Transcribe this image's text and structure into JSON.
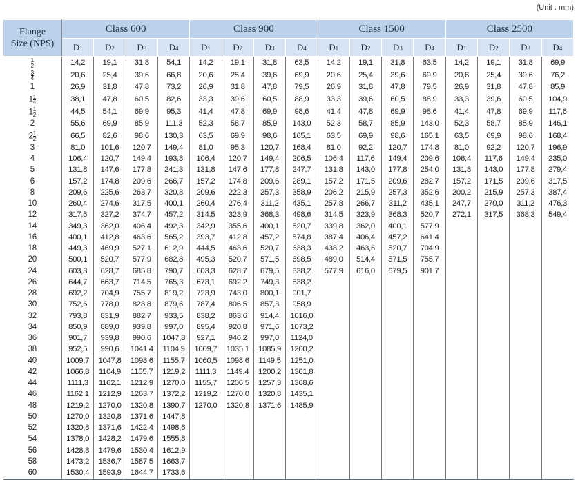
{
  "unit_note": "(Unit : mm)",
  "header": {
    "flange_size": [
      "Flange",
      "Size (NPS)"
    ],
    "classes": [
      "Class 600",
      "Class 900",
      "Class 1500",
      "Class 2500"
    ],
    "dims": [
      "D",
      "D",
      "D",
      "D"
    ],
    "dim_subs": [
      "1",
      "2",
      "3",
      "4"
    ]
  },
  "rows": [
    {
      "size": {
        "whole": "",
        "num": "1",
        "den": "2"
      },
      "vals": [
        "14,2",
        "19,1",
        "31,8",
        "54,1",
        "14,2",
        "19,1",
        "31,8",
        "63,5",
        "14,2",
        "19,1",
        "31,8",
        "63,5",
        "14,2",
        "19,1",
        "31,8",
        "69,9"
      ]
    },
    {
      "size": {
        "whole": "",
        "num": "3",
        "den": "4"
      },
      "vals": [
        "20,6",
        "25,4",
        "39,6",
        "66,8",
        "20,6",
        "25,4",
        "39,6",
        "69,9",
        "20,6",
        "25,4",
        "39,6",
        "69,9",
        "20,6",
        "25,4",
        "39,6",
        "76,2"
      ]
    },
    {
      "size": {
        "whole": "1"
      },
      "vals": [
        "26,9",
        "31,8",
        "47,8",
        "73,2",
        "26,9",
        "31,8",
        "47,8",
        "79,5",
        "26,9",
        "31,8",
        "47,8",
        "79,5",
        "26,9",
        "31,8",
        "47,8",
        "85,9"
      ]
    },
    {
      "size": {
        "whole": "1",
        "num": "1",
        "den": "4"
      },
      "vals": [
        "38,1",
        "47,8",
        "60,5",
        "82,6",
        "33,3",
        "39,6",
        "60,5",
        "88,9",
        "33,3",
        "39,6",
        "60,5",
        "88,9",
        "33,3",
        "39,6",
        "60,5",
        "104,9"
      ]
    },
    {
      "size": {
        "whole": "1",
        "num": "1",
        "den": "2"
      },
      "vals": [
        "44,5",
        "54,1",
        "69,9",
        "95,3",
        "41,4",
        "47,8",
        "69,9",
        "98,6",
        "41,4",
        "47,8",
        "69,9",
        "98,6",
        "41,4",
        "47,8",
        "69,9",
        "117,6"
      ]
    },
    {
      "size": {
        "whole": "2"
      },
      "vals": [
        "55,6",
        "69,9",
        "85,9",
        "111,3",
        "52,3",
        "58,7",
        "85,9",
        "143,0",
        "52,3",
        "58,7",
        "85,9",
        "143,0",
        "52,3",
        "58,7",
        "85,9",
        "146,1"
      ]
    },
    {
      "size": {
        "whole": "2",
        "num": "1",
        "den": "2"
      },
      "vals": [
        "66,5",
        "82,6",
        "98,6",
        "130,3",
        "63,5",
        "69,9",
        "98,6",
        "165,1",
        "63,5",
        "69,9",
        "98,6",
        "165,1",
        "63,5",
        "69,9",
        "98,6",
        "168,4"
      ]
    },
    {
      "size": {
        "whole": "3"
      },
      "vals": [
        "81,0",
        "101,6",
        "120,7",
        "149,4",
        "81,0",
        "95,3",
        "120,7",
        "168,4",
        "81,0",
        "92,2",
        "120,7",
        "174,8",
        "81,0",
        "92,2",
        "120,7",
        "196,9"
      ]
    },
    {
      "size": {
        "whole": "4"
      },
      "vals": [
        "106,4",
        "120,7",
        "149,4",
        "193,8",
        "106,4",
        "120,7",
        "149,4",
        "206,5",
        "106,4",
        "117,6",
        "149,4",
        "209,6",
        "106,4",
        "117,6",
        "149,4",
        "235,0"
      ]
    },
    {
      "size": {
        "whole": "5"
      },
      "vals": [
        "131,8",
        "147,6",
        "177,8",
        "241,3",
        "131,8",
        "147,6",
        "177,8",
        "247,7",
        "131,8",
        "143,0",
        "177,8",
        "254,0",
        "131,8",
        "143,0",
        "177,8",
        "279,4"
      ]
    },
    {
      "size": {
        "whole": "6"
      },
      "vals": [
        "157,2",
        "174,8",
        "209,6",
        "266,7",
        "157,2",
        "174,8",
        "209,6",
        "289,1",
        "157,2",
        "171,5",
        "209,6",
        "282,7",
        "157,2",
        "171,5",
        "209,6",
        "317,5"
      ]
    },
    {
      "size": {
        "whole": "8"
      },
      "vals": [
        "209,6",
        "225,6",
        "263,7",
        "320,8",
        "209,6",
        "222,3",
        "257,3",
        "358,9",
        "206,2",
        "215,9",
        "257,3",
        "352,6",
        "200,2",
        "215,9",
        "257,3",
        "387,4"
      ]
    },
    {
      "size": {
        "whole": "10"
      },
      "vals": [
        "260,4",
        "274,6",
        "317,5",
        "400,1",
        "260,4",
        "276,4",
        "311,2",
        "435,1",
        "257,8",
        "266,7",
        "311,2",
        "435,1",
        "247,7",
        "270,0",
        "311,2",
        "476,3"
      ]
    },
    {
      "size": {
        "whole": "12"
      },
      "vals": [
        "317,5",
        "327,2",
        "374,7",
        "457,2",
        "314,5",
        "323,9",
        "368,3",
        "498,6",
        "314,5",
        "323,9",
        "368,3",
        "520,7",
        "272,1",
        "317,5",
        "368,3",
        "549,4"
      ]
    },
    {
      "size": {
        "whole": "14"
      },
      "vals": [
        "349,3",
        "362,0",
        "406,4",
        "492,3",
        "342,9",
        "355,6",
        "400,1",
        "520,7",
        "339,8",
        "362,0",
        "400,1",
        "577,9",
        "",
        "",
        "",
        ""
      ]
    },
    {
      "size": {
        "whole": "16"
      },
      "vals": [
        "400,1",
        "412,8",
        "463,6",
        "565,2",
        "393,7",
        "412,8",
        "457,2",
        "574,8",
        "387,4",
        "406,4",
        "457,2",
        "641,4",
        "",
        "",
        "",
        ""
      ]
    },
    {
      "size": {
        "whole": "18"
      },
      "vals": [
        "449,3",
        "469,9",
        "527,1",
        "612,9",
        "444,5",
        "463,6",
        "520,7",
        "638,3",
        "438,2",
        "463,6",
        "520,7",
        "704,9",
        "",
        "",
        "",
        ""
      ]
    },
    {
      "size": {
        "whole": "20"
      },
      "vals": [
        "500,1",
        "520,7",
        "577,9",
        "682,8",
        "495,3",
        "520,7",
        "571,5",
        "698,5",
        "489,0",
        "514,4",
        "571,5",
        "755,7",
        "",
        "",
        "",
        ""
      ]
    },
    {
      "size": {
        "whole": "24"
      },
      "vals": [
        "603,3",
        "628,7",
        "685,8",
        "790,7",
        "603,3",
        "628,7",
        "679,5",
        "838,2",
        "577,9",
        "616,0",
        "679,5",
        "901,7",
        "",
        "",
        "",
        ""
      ]
    },
    {
      "size": {
        "whole": "26"
      },
      "vals": [
        "644,7",
        "663,7",
        "714,5",
        "765,3",
        "673,1",
        "692,2",
        "749,3",
        "838,2",
        "",
        "",
        "",
        "",
        "",
        "",
        "",
        ""
      ]
    },
    {
      "size": {
        "whole": "28"
      },
      "vals": [
        "692,2",
        "704,9",
        "755,7",
        "819,2",
        "723,9",
        "743,0",
        "800,1",
        "901,7",
        "",
        "",
        "",
        "",
        "",
        "",
        "",
        ""
      ]
    },
    {
      "size": {
        "whole": "30"
      },
      "vals": [
        "752,6",
        "778,0",
        "828,8",
        "879,6",
        "787,4",
        "806,5",
        "857,3",
        "958,9",
        "",
        "",
        "",
        "",
        "",
        "",
        "",
        ""
      ]
    },
    {
      "size": {
        "whole": "32"
      },
      "vals": [
        "793,8",
        "831,9",
        "882,7",
        "933,5",
        "838,2",
        "863,6",
        "914,4",
        "1016,0",
        "",
        "",
        "",
        "",
        "",
        "",
        "",
        ""
      ]
    },
    {
      "size": {
        "whole": "34"
      },
      "vals": [
        "850,9",
        "889,0",
        "939,8",
        "997,0",
        "895,4",
        "920,8",
        "971,6",
        "1073,2",
        "",
        "",
        "",
        "",
        "",
        "",
        "",
        ""
      ]
    },
    {
      "size": {
        "whole": "36"
      },
      "vals": [
        "901,7",
        "939,8",
        "990,6",
        "1047,8",
        "927,1",
        "946,2",
        "997,0",
        "1124,0",
        "",
        "",
        "",
        "",
        "",
        "",
        "",
        ""
      ]
    },
    {
      "size": {
        "whole": "38"
      },
      "vals": [
        "952,5",
        "990,6",
        "1041,4",
        "1104,9",
        "1009,7",
        "1035,1",
        "1085,9",
        "1200,2",
        "",
        "",
        "",
        "",
        "",
        "",
        "",
        ""
      ]
    },
    {
      "size": {
        "whole": "40"
      },
      "vals": [
        "1009,7",
        "1047,8",
        "1098,6",
        "1155,7",
        "1060,5",
        "1098,6",
        "1149,5",
        "1251,0",
        "",
        "",
        "",
        "",
        "",
        "",
        "",
        ""
      ]
    },
    {
      "size": {
        "whole": "42"
      },
      "vals": [
        "1066,8",
        "1104,9",
        "1155,7",
        "1219,2",
        "1111,3",
        "1149,4",
        "1200,2",
        "1301,8",
        "",
        "",
        "",
        "",
        "",
        "",
        "",
        ""
      ]
    },
    {
      "size": {
        "whole": "44"
      },
      "vals": [
        "1111,3",
        "1162,1",
        "1212,9",
        "1270,0",
        "1155,7",
        "1206,5",
        "1257,3",
        "1368,6",
        "",
        "",
        "",
        "",
        "",
        "",
        "",
        ""
      ]
    },
    {
      "size": {
        "whole": "46"
      },
      "vals": [
        "1162,1",
        "1212,9",
        "1263,7",
        "1372,2",
        "1219,2",
        "1270,0",
        "1320,8",
        "1435,1",
        "",
        "",
        "",
        "",
        "",
        "",
        "",
        ""
      ]
    },
    {
      "size": {
        "whole": "48"
      },
      "vals": [
        "1219,2",
        "1270,0",
        "1320,8",
        "1390,7",
        "1270,0",
        "1320,8",
        "1371,6",
        "1485,9",
        "",
        "",
        "",
        "",
        "",
        "",
        "",
        ""
      ]
    },
    {
      "size": {
        "whole": "50"
      },
      "vals": [
        "1270,0",
        "1320,8",
        "1371,6",
        "1447,8",
        "",
        "",
        "",
        "",
        "",
        "",
        "",
        "",
        "",
        "",
        "",
        ""
      ]
    },
    {
      "size": {
        "whole": "52"
      },
      "vals": [
        "1320,8",
        "1371,6",
        "1422,4",
        "1498,6",
        "",
        "",
        "",
        "",
        "",
        "",
        "",
        "",
        "",
        "",
        "",
        ""
      ]
    },
    {
      "size": {
        "whole": "54"
      },
      "vals": [
        "1378,0",
        "1428,2",
        "1479,6",
        "1555,8",
        "",
        "",
        "",
        "",
        "",
        "",
        "",
        "",
        "",
        "",
        "",
        ""
      ]
    },
    {
      "size": {
        "whole": "56"
      },
      "vals": [
        "1428,8",
        "1479,6",
        "1530,4",
        "1612,9",
        "",
        "",
        "",
        "",
        "",
        "",
        "",
        "",
        "",
        "",
        "",
        ""
      ]
    },
    {
      "size": {
        "whole": "58"
      },
      "vals": [
        "1473,2",
        "1536,7",
        "1587,5",
        "1663,7",
        "",
        "",
        "",
        "",
        "",
        "",
        "",
        "",
        "",
        "",
        "",
        ""
      ]
    },
    {
      "size": {
        "whole": "60"
      },
      "vals": [
        "1530,4",
        "1593,9",
        "1644,7",
        "1733,6",
        "",
        "",
        "",
        "",
        "",
        "",
        "",
        "",
        "",
        "",
        "",
        ""
      ]
    }
  ]
}
